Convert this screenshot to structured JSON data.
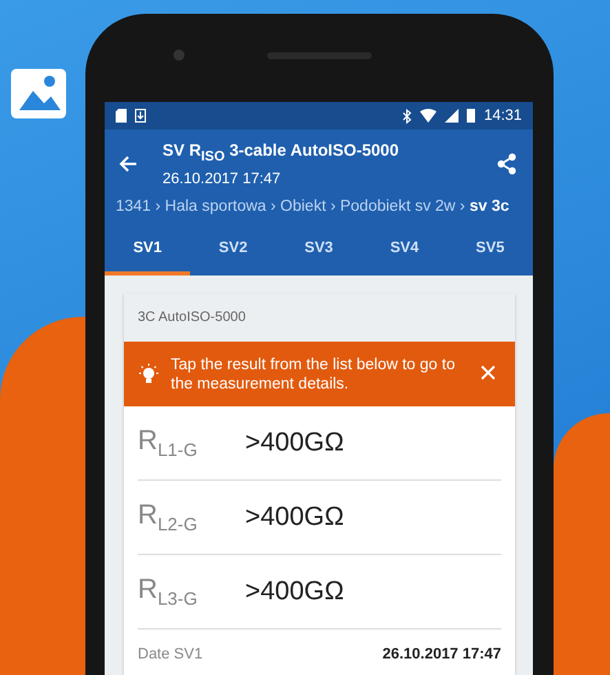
{
  "status_bar": {
    "time": "14:31"
  },
  "app_bar": {
    "title": "SV R$_{ISO}$ 3-cable AutoISO-5000",
    "subtitle": "26.10.2017 17:47"
  },
  "breadcrumb": "1341 › Hala sportowa › Obiekt › Podobiekt sv 2w › **sv 3c**",
  "tabs": [
    {
      "label": "SV1",
      "selected": true
    },
    {
      "label": "SV2",
      "selected": false
    },
    {
      "label": "SV3",
      "selected": false
    },
    {
      "label": "SV4",
      "selected": false
    },
    {
      "label": "SV5",
      "selected": false
    }
  ],
  "card": {
    "header": "3C AutoISO-5000",
    "banner": {
      "text": "Tap the result from the list below to go to the measurement details."
    },
    "results": [
      {
        "label": "R$_{L1-G}$",
        "value": ">400GΩ"
      },
      {
        "label": "R$_{L2-G}$",
        "value": ">400GΩ"
      },
      {
        "label": "R$_{L3-G}$",
        "value": ">400GΩ"
      }
    ],
    "date": {
      "label": "Date SV1",
      "value": "26.10.2017 17:47"
    }
  }
}
